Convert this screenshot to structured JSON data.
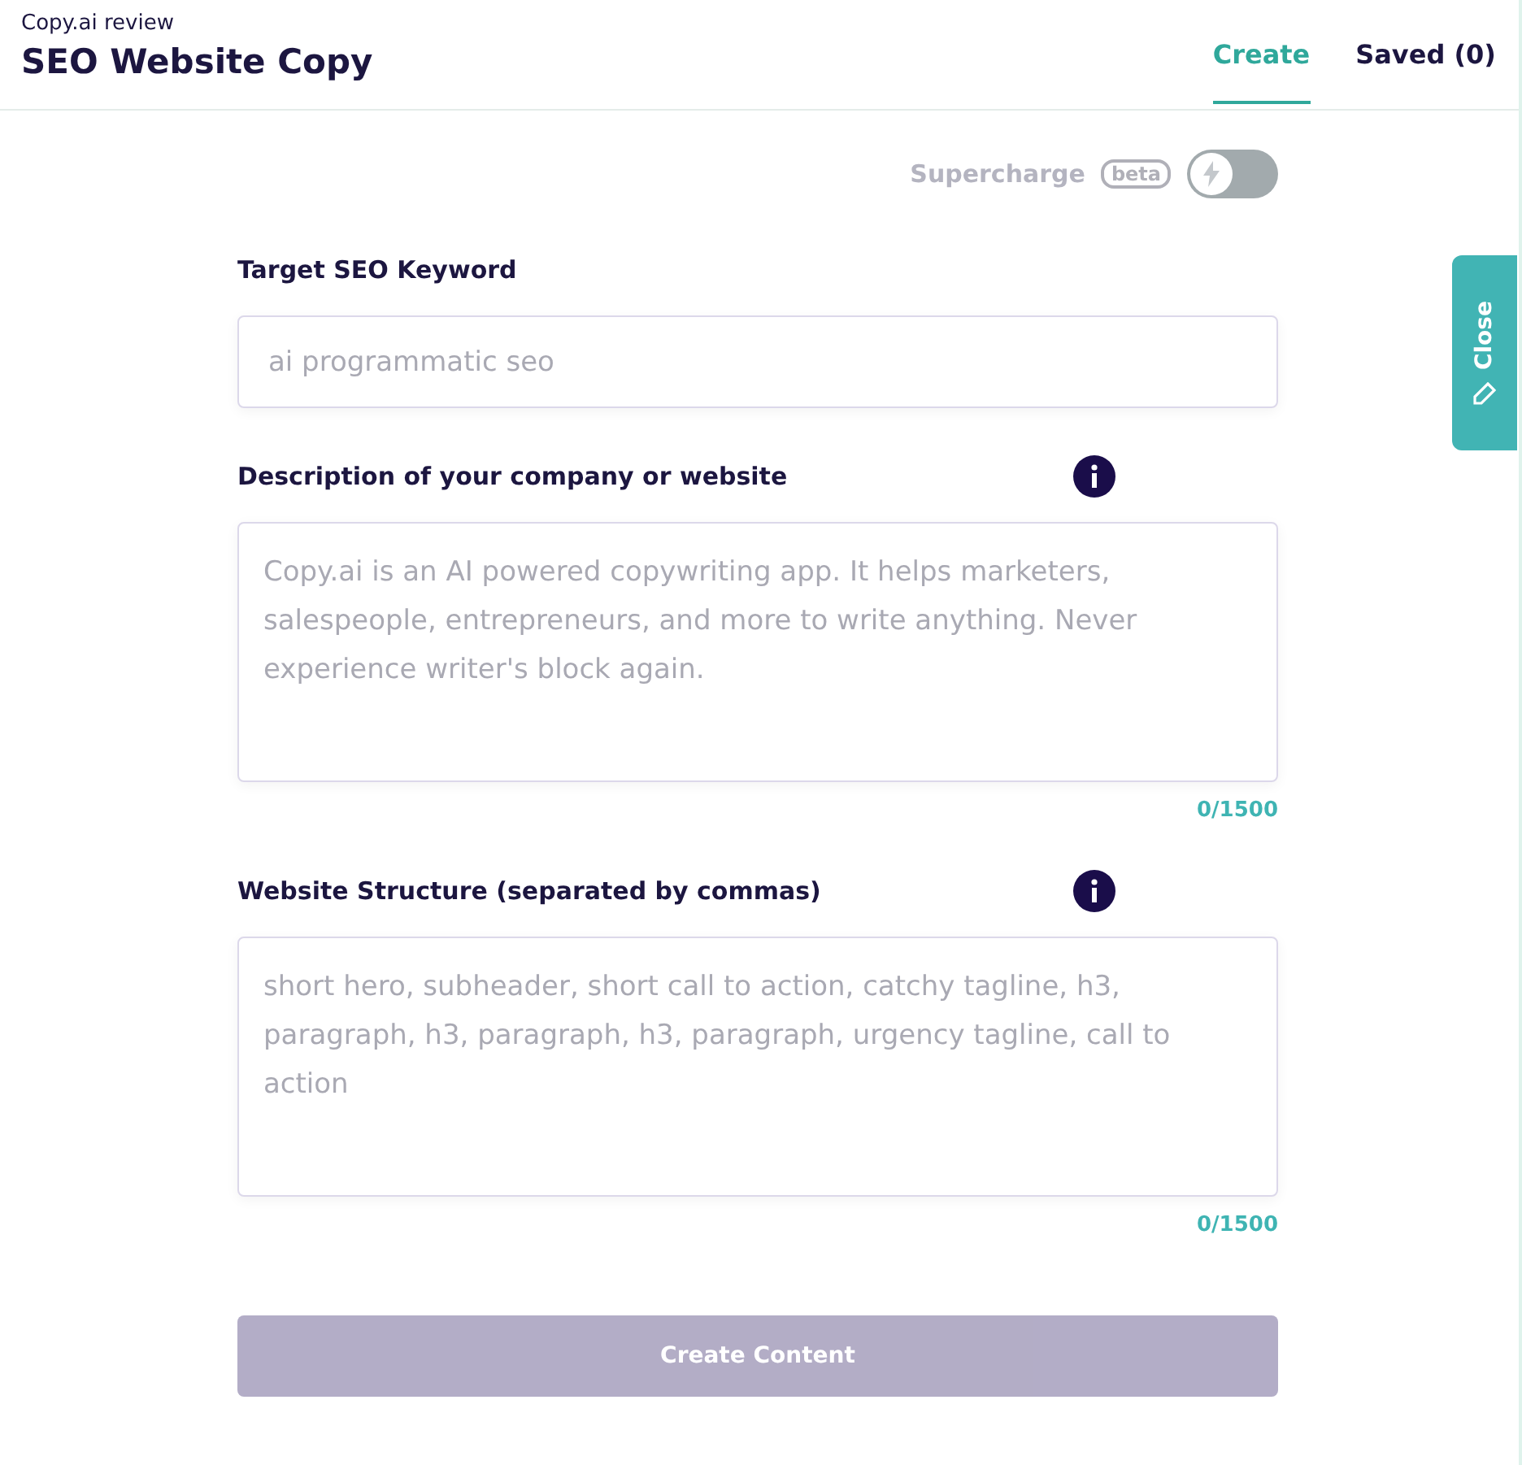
{
  "header": {
    "breadcrumb": "Copy.ai review",
    "title": "SEO Website Copy"
  },
  "tabs": [
    {
      "label": "Create",
      "selected": true
    },
    {
      "label": "Saved (0)",
      "selected": false
    }
  ],
  "supercharge": {
    "label": "Supercharge",
    "badge": "beta",
    "on": false
  },
  "fields": [
    {
      "kind": "input",
      "label": "Target SEO Keyword",
      "placeholder": "ai programmatic seo",
      "info": false
    },
    {
      "kind": "textarea",
      "label": "Description of your company or website",
      "placeholder": "Copy.ai is an AI powered copywriting app. It helps marketers, salespeople, entrepreneurs, and more to write anything. Never experience writer's block again.",
      "info": true,
      "counter": "0/1500"
    },
    {
      "kind": "textarea",
      "label": "Website Structure (separated by commas)",
      "placeholder": "short hero, subheader, short call to action, catchy tagline, h3, paragraph, h3, paragraph, h3, paragraph, urgency tagline, call to action",
      "info": true,
      "counter": "0/1500"
    }
  ],
  "submit": {
    "label": "Create Content",
    "disabled": true
  },
  "side_tab": {
    "label": "Close"
  }
}
